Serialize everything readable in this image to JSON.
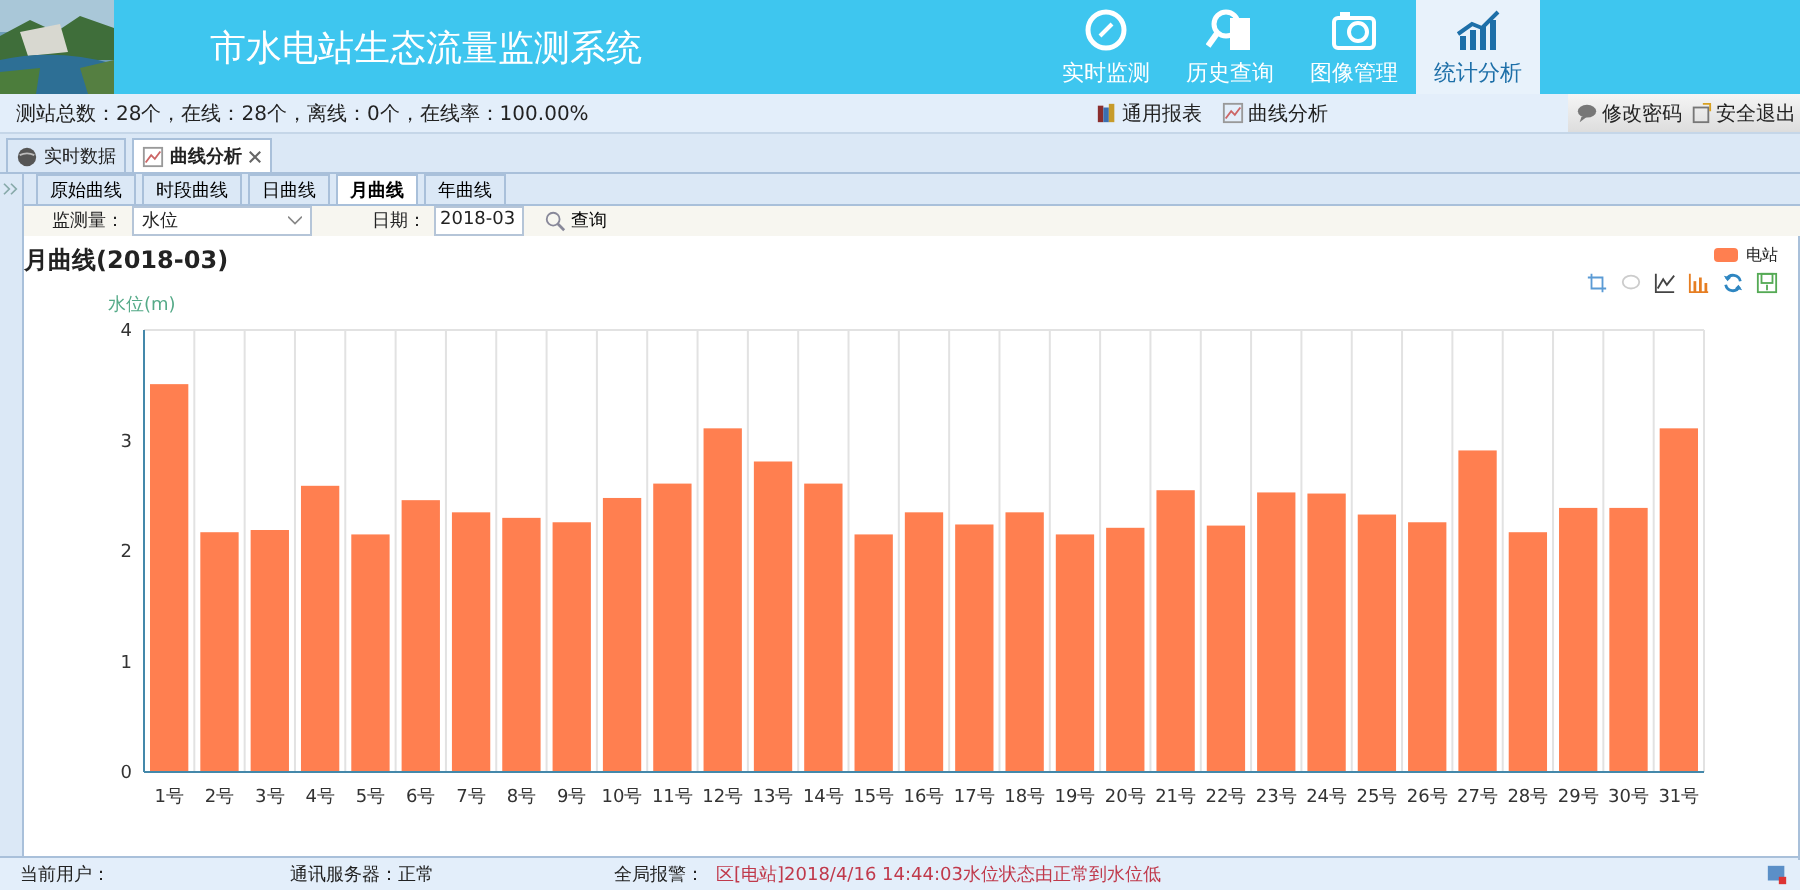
{
  "header": {
    "title": "市水电站生态流量监测系统",
    "nav": [
      {
        "label": "实时监测",
        "selected": false
      },
      {
        "label": "历史查询",
        "selected": false
      },
      {
        "label": "图像管理",
        "selected": false
      },
      {
        "label": "统计分析",
        "selected": true
      }
    ]
  },
  "info_bar": {
    "summary": "测站总数：28个，在线：28个，离线：0个，在线率：100.00%",
    "links": [
      "通用报表",
      "曲线分析"
    ],
    "actions": [
      "修改密码",
      "安全退出"
    ]
  },
  "page_tabs": [
    {
      "label": "实时数据",
      "closable": false,
      "selected": false
    },
    {
      "label": "曲线分析",
      "closable": true,
      "selected": true
    }
  ],
  "curve_tabs": [
    {
      "label": "原始曲线",
      "selected": false
    },
    {
      "label": "时段曲线",
      "selected": false
    },
    {
      "label": "日曲线",
      "selected": false
    },
    {
      "label": "月曲线",
      "selected": true
    },
    {
      "label": "年曲线",
      "selected": false
    }
  ],
  "filter": {
    "measure_label": "监测量：",
    "measure_value": "水位",
    "date_label": "日期：",
    "date_value": "2018-03",
    "query_button": "查询"
  },
  "chart_title": "月曲线(2018-03)",
  "chart_data": {
    "type": "bar",
    "ylabel": "水位(m)",
    "categories": [
      "1号",
      "2号",
      "3号",
      "4号",
      "5号",
      "6号",
      "7号",
      "8号",
      "9号",
      "10号",
      "11号",
      "12号",
      "13号",
      "14号",
      "15号",
      "16号",
      "17号",
      "18号",
      "19号",
      "20号",
      "21号",
      "22号",
      "23号",
      "24号",
      "25号",
      "26号",
      "27号",
      "28号",
      "29号",
      "30号",
      "31号"
    ],
    "series": [
      {
        "name": "电站",
        "color": "#ff7f50",
        "values": [
          3.51,
          2.17,
          2.19,
          2.59,
          2.15,
          2.46,
          2.35,
          2.3,
          2.26,
          2.48,
          2.61,
          3.11,
          2.81,
          2.61,
          2.15,
          2.35,
          2.24,
          2.35,
          2.15,
          2.21,
          2.55,
          2.23,
          2.53,
          2.52,
          2.33,
          2.26,
          2.91,
          2.17,
          2.39,
          2.39,
          3.11
        ]
      }
    ],
    "ylim": [
      0,
      4
    ],
    "yticks": [
      0,
      1,
      2,
      3,
      4
    ]
  },
  "status_bar": {
    "user_label": "当前用户：",
    "server_label": "通讯服务器：",
    "server_value": "正常",
    "alarm_label": "全局报警：",
    "alarm_text": "区[电站]2018/4/16 14:44:03水位状态由正常到水位低"
  }
}
